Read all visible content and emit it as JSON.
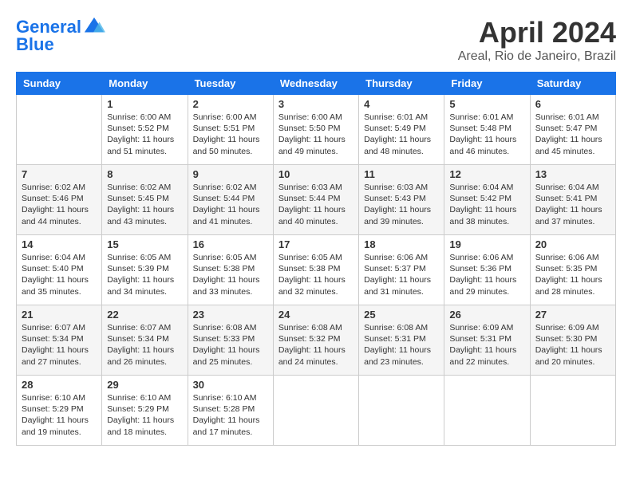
{
  "header": {
    "logo_line1": "General",
    "logo_line2": "Blue",
    "month": "April 2024",
    "location": "Areal, Rio de Janeiro, Brazil"
  },
  "weekdays": [
    "Sunday",
    "Monday",
    "Tuesday",
    "Wednesday",
    "Thursday",
    "Friday",
    "Saturday"
  ],
  "weeks": [
    [
      {
        "day": "",
        "info": ""
      },
      {
        "day": "1",
        "info": "Sunrise: 6:00 AM\nSunset: 5:52 PM\nDaylight: 11 hours\nand 51 minutes."
      },
      {
        "day": "2",
        "info": "Sunrise: 6:00 AM\nSunset: 5:51 PM\nDaylight: 11 hours\nand 50 minutes."
      },
      {
        "day": "3",
        "info": "Sunrise: 6:00 AM\nSunset: 5:50 PM\nDaylight: 11 hours\nand 49 minutes."
      },
      {
        "day": "4",
        "info": "Sunrise: 6:01 AM\nSunset: 5:49 PM\nDaylight: 11 hours\nand 48 minutes."
      },
      {
        "day": "5",
        "info": "Sunrise: 6:01 AM\nSunset: 5:48 PM\nDaylight: 11 hours\nand 46 minutes."
      },
      {
        "day": "6",
        "info": "Sunrise: 6:01 AM\nSunset: 5:47 PM\nDaylight: 11 hours\nand 45 minutes."
      }
    ],
    [
      {
        "day": "7",
        "info": "Sunrise: 6:02 AM\nSunset: 5:46 PM\nDaylight: 11 hours\nand 44 minutes."
      },
      {
        "day": "8",
        "info": "Sunrise: 6:02 AM\nSunset: 5:45 PM\nDaylight: 11 hours\nand 43 minutes."
      },
      {
        "day": "9",
        "info": "Sunrise: 6:02 AM\nSunset: 5:44 PM\nDaylight: 11 hours\nand 41 minutes."
      },
      {
        "day": "10",
        "info": "Sunrise: 6:03 AM\nSunset: 5:44 PM\nDaylight: 11 hours\nand 40 minutes."
      },
      {
        "day": "11",
        "info": "Sunrise: 6:03 AM\nSunset: 5:43 PM\nDaylight: 11 hours\nand 39 minutes."
      },
      {
        "day": "12",
        "info": "Sunrise: 6:04 AM\nSunset: 5:42 PM\nDaylight: 11 hours\nand 38 minutes."
      },
      {
        "day": "13",
        "info": "Sunrise: 6:04 AM\nSunset: 5:41 PM\nDaylight: 11 hours\nand 37 minutes."
      }
    ],
    [
      {
        "day": "14",
        "info": "Sunrise: 6:04 AM\nSunset: 5:40 PM\nDaylight: 11 hours\nand 35 minutes."
      },
      {
        "day": "15",
        "info": "Sunrise: 6:05 AM\nSunset: 5:39 PM\nDaylight: 11 hours\nand 34 minutes."
      },
      {
        "day": "16",
        "info": "Sunrise: 6:05 AM\nSunset: 5:38 PM\nDaylight: 11 hours\nand 33 minutes."
      },
      {
        "day": "17",
        "info": "Sunrise: 6:05 AM\nSunset: 5:38 PM\nDaylight: 11 hours\nand 32 minutes."
      },
      {
        "day": "18",
        "info": "Sunrise: 6:06 AM\nSunset: 5:37 PM\nDaylight: 11 hours\nand 31 minutes."
      },
      {
        "day": "19",
        "info": "Sunrise: 6:06 AM\nSunset: 5:36 PM\nDaylight: 11 hours\nand 29 minutes."
      },
      {
        "day": "20",
        "info": "Sunrise: 6:06 AM\nSunset: 5:35 PM\nDaylight: 11 hours\nand 28 minutes."
      }
    ],
    [
      {
        "day": "21",
        "info": "Sunrise: 6:07 AM\nSunset: 5:34 PM\nDaylight: 11 hours\nand 27 minutes."
      },
      {
        "day": "22",
        "info": "Sunrise: 6:07 AM\nSunset: 5:34 PM\nDaylight: 11 hours\nand 26 minutes."
      },
      {
        "day": "23",
        "info": "Sunrise: 6:08 AM\nSunset: 5:33 PM\nDaylight: 11 hours\nand 25 minutes."
      },
      {
        "day": "24",
        "info": "Sunrise: 6:08 AM\nSunset: 5:32 PM\nDaylight: 11 hours\nand 24 minutes."
      },
      {
        "day": "25",
        "info": "Sunrise: 6:08 AM\nSunset: 5:31 PM\nDaylight: 11 hours\nand 23 minutes."
      },
      {
        "day": "26",
        "info": "Sunrise: 6:09 AM\nSunset: 5:31 PM\nDaylight: 11 hours\nand 22 minutes."
      },
      {
        "day": "27",
        "info": "Sunrise: 6:09 AM\nSunset: 5:30 PM\nDaylight: 11 hours\nand 20 minutes."
      }
    ],
    [
      {
        "day": "28",
        "info": "Sunrise: 6:10 AM\nSunset: 5:29 PM\nDaylight: 11 hours\nand 19 minutes."
      },
      {
        "day": "29",
        "info": "Sunrise: 6:10 AM\nSunset: 5:29 PM\nDaylight: 11 hours\nand 18 minutes."
      },
      {
        "day": "30",
        "info": "Sunrise: 6:10 AM\nSunset: 5:28 PM\nDaylight: 11 hours\nand 17 minutes."
      },
      {
        "day": "",
        "info": ""
      },
      {
        "day": "",
        "info": ""
      },
      {
        "day": "",
        "info": ""
      },
      {
        "day": "",
        "info": ""
      }
    ]
  ]
}
